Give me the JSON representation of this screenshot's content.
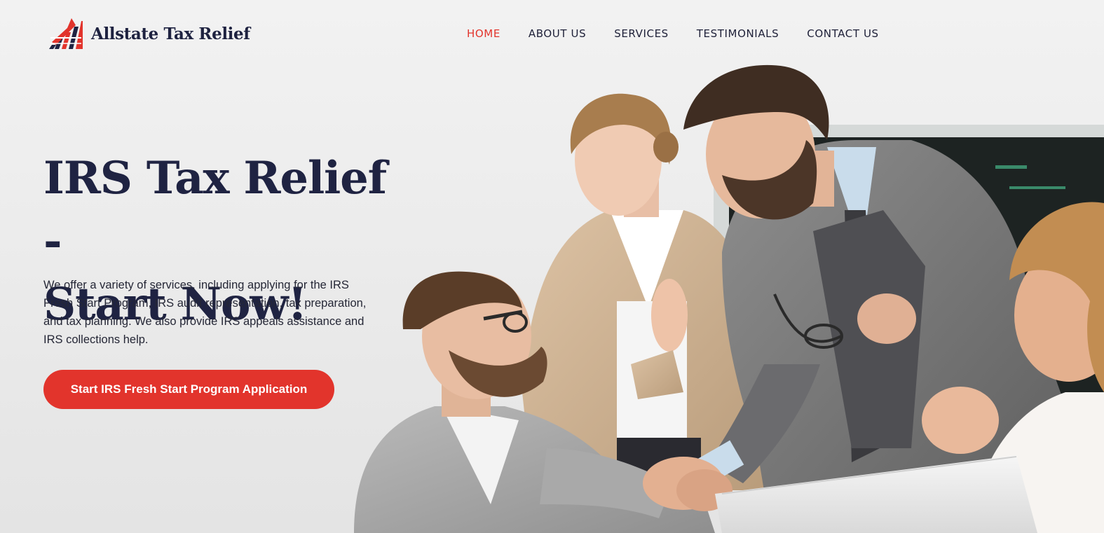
{
  "brand": {
    "name": "Allstate Tax Relief",
    "logo_icon": "rising-bars-logo-icon"
  },
  "nav": {
    "items": [
      {
        "label": "HOME",
        "active": true
      },
      {
        "label": "ABOUT US",
        "active": false
      },
      {
        "label": "SERVICES",
        "active": false
      },
      {
        "label": "TESTIMONIALS",
        "active": false
      },
      {
        "label": "CONTACT US",
        "active": false
      }
    ]
  },
  "hero": {
    "title_line1": "IRS Tax Relief -",
    "title_line2": "Start Now!",
    "description": "We offer a variety of services, including applying for the IRS Fresh Start Program, IRS audit representation, tax preparation, and tax planning. We also provide IRS appeals assistance and IRS collections help.",
    "cta_label": "Start IRS Fresh Start Program Application"
  },
  "colors": {
    "accent": "#e2342c",
    "navy": "#1f2342",
    "background": "#eeeeee"
  }
}
